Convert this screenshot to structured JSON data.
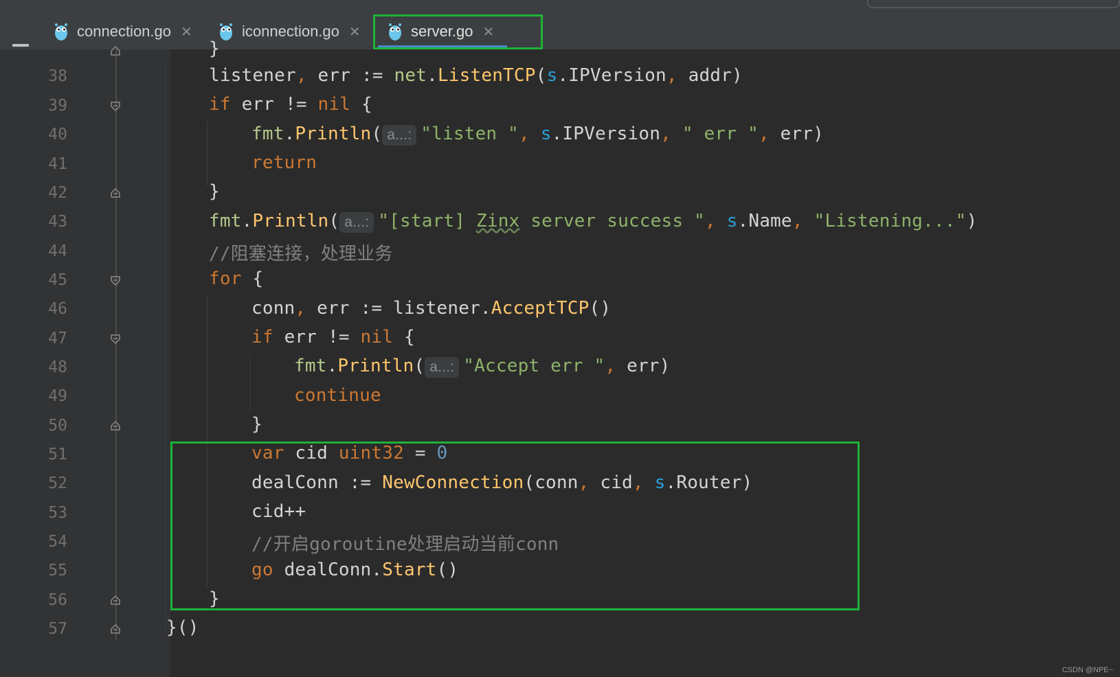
{
  "tabs": [
    {
      "label": "connection.go",
      "active": false
    },
    {
      "label": "iconnection.go",
      "active": false
    },
    {
      "label": "server.go",
      "active": true
    }
  ],
  "code": {
    "partial_top": "}",
    "lines": [
      {
        "num": "38",
        "text": "listener, err := net.ListenTCP(s.IPVersion, addr)"
      },
      {
        "num": "39",
        "text": "if err != nil {"
      },
      {
        "num": "40",
        "hint": "a...:",
        "text": "fmt.Println(\"listen \", s.IPVersion, \" err \", err)"
      },
      {
        "num": "41",
        "text": "return"
      },
      {
        "num": "42",
        "text": "}"
      },
      {
        "num": "43",
        "hint": "a...:",
        "text": "fmt.Println(\"[start] Zinx server success \", s.Name, \"Listening...\")"
      },
      {
        "num": "44",
        "text": "//阻塞连接，处理业务"
      },
      {
        "num": "45",
        "text": "for {"
      },
      {
        "num": "46",
        "text": "conn, err := listener.AcceptTCP()"
      },
      {
        "num": "47",
        "text": "if err != nil {"
      },
      {
        "num": "48",
        "hint": "a...:",
        "text": "fmt.Println(\"Accept err \", err)"
      },
      {
        "num": "49",
        "text": "continue"
      },
      {
        "num": "50",
        "text": "}"
      },
      {
        "num": "51",
        "text": "var cid uint32 = 0"
      },
      {
        "num": "52",
        "text": "dealConn := NewConnection(conn, cid, s.Router)"
      },
      {
        "num": "53",
        "text": "cid++"
      },
      {
        "num": "54",
        "text": "//开启goroutine处理启动当前conn"
      },
      {
        "num": "55",
        "text": "go dealConn.Start()"
      },
      {
        "num": "56",
        "text": "}"
      },
      {
        "num": "57",
        "text": "}()"
      }
    ]
  },
  "watermark": "CSDN @NPE~",
  "colors": {
    "highlight_box": "#1db33a",
    "keyword": "#cc7832",
    "string": "#8eb36a",
    "function": "#ffc66d",
    "receiver": "#2d9fd9"
  }
}
